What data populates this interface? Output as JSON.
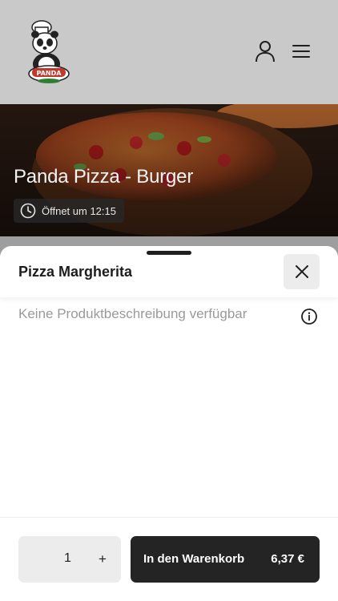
{
  "header": {
    "logo_text": "PANDA",
    "account_icon": "user-icon",
    "menu_icon": "hamburger-menu-icon"
  },
  "restaurant": {
    "name": "Panda Pizza - Burger",
    "status": "Öffnet um 12:15",
    "status_icon": "clock-icon"
  },
  "product_sheet": {
    "title": "Pizza Margherita",
    "close_icon": "close-icon",
    "description": "Keine Produktbeschreibung verfügbar",
    "info_icon": "info-icon"
  },
  "footer": {
    "quantity": "1",
    "plus_label": "+",
    "add_to_cart_label": "In den Warenkorb",
    "price": "6,37 €"
  },
  "colors": {
    "header_bg": "#c9c9c9",
    "primary_button": "#242424",
    "muted_text": "#9a9a9a"
  }
}
